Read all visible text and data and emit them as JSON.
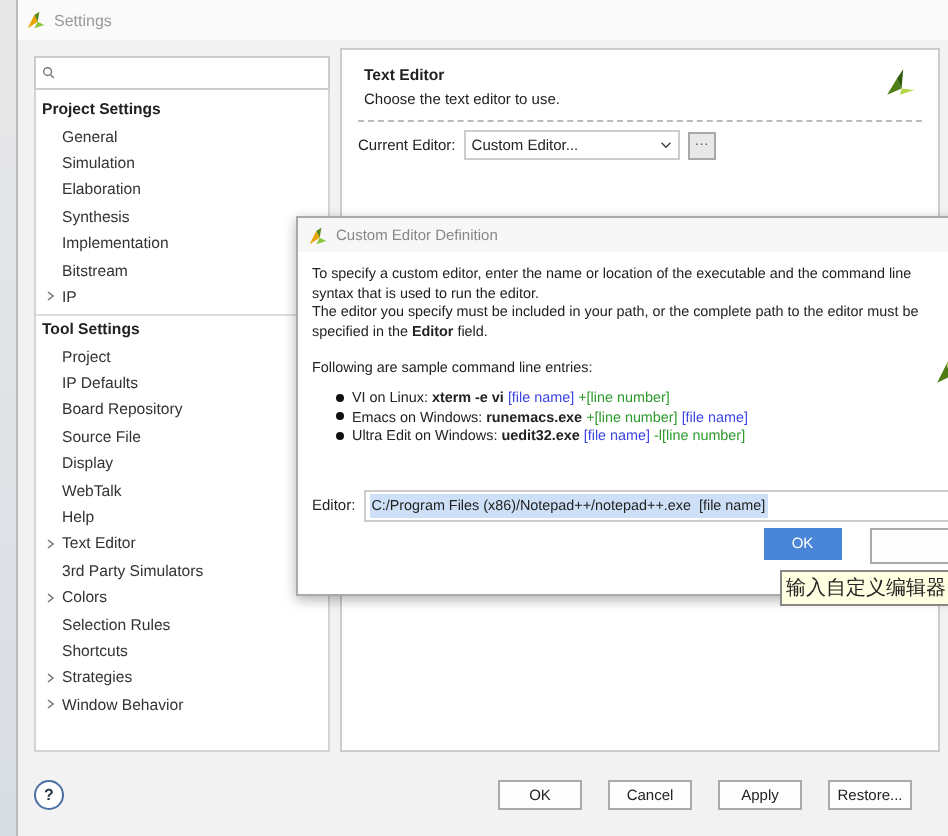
{
  "window": {
    "title": "Settings"
  },
  "tree": [
    {
      "label": "Project Settings",
      "kind": "header"
    },
    {
      "label": "General",
      "kind": "item"
    },
    {
      "label": "Simulation",
      "kind": "item"
    },
    {
      "label": "Elaboration",
      "kind": "item"
    },
    {
      "label": "Synthesis",
      "kind": "item"
    },
    {
      "label": "Implementation",
      "kind": "item"
    },
    {
      "label": "Bitstream",
      "kind": "item"
    },
    {
      "label": "IP",
      "kind": "item",
      "expanded": false
    },
    {
      "label": "Tool Settings",
      "kind": "header"
    },
    {
      "label": "Project",
      "kind": "item"
    },
    {
      "label": "IP Defaults",
      "kind": "item"
    },
    {
      "label": "Board Repository",
      "kind": "item"
    },
    {
      "label": "Source File",
      "kind": "item"
    },
    {
      "label": "Display",
      "kind": "item"
    },
    {
      "label": "WebTalk",
      "kind": "item"
    },
    {
      "label": "Help",
      "kind": "item"
    },
    {
      "label": "Text Editor",
      "kind": "item",
      "expanded": false
    },
    {
      "label": "3rd Party Simulators",
      "kind": "item"
    },
    {
      "label": "Colors",
      "kind": "item",
      "expanded": false
    },
    {
      "label": "Selection Rules",
      "kind": "item"
    },
    {
      "label": "Shortcuts",
      "kind": "item"
    },
    {
      "label": "Strategies",
      "kind": "item",
      "expanded": false
    },
    {
      "label": "Window Behavior",
      "kind": "item",
      "expanded": false
    }
  ],
  "panel": {
    "title": "Text Editor",
    "description": "Choose the text editor to use.",
    "editor_label": "Current Editor:",
    "editor_value": "Custom Editor...",
    "browse_button": "···"
  },
  "help_button": "?",
  "buttons": [
    "OK",
    "Cancel",
    "Apply",
    "Restore..."
  ],
  "dialog": {
    "title": "Custom Editor Definition",
    "paragraphs": [
      "To specify a custom editor, enter the name or location of the executable and the command line syntax that is used to run the editor.",
      "The editor you specify must be included in your path, or the complete path to the editor must be specified in the **Editor** field.",
      "Following are sample command line entries:"
    ],
    "samples": [
      [
        {
          "kind": "plain",
          "text": "VI on Linux:"
        },
        {
          "kind": "command",
          "text": "xterm -e vi"
        },
        {
          "kind": "file",
          "text": "[file name]"
        },
        {
          "kind": "line",
          "text": "+[line number]"
        }
      ],
      [
        {
          "kind": "plain",
          "text": "Emacs on Windows:"
        },
        {
          "kind": "command",
          "text": "runemacs.exe"
        },
        {
          "kind": "line",
          "text": "+[line number]"
        },
        {
          "kind": "file",
          "text": "[file name]"
        }
      ],
      [
        {
          "kind": "plain",
          "text": "Ultra Edit on Windows:"
        },
        {
          "kind": "command",
          "text": "uedit32.exe"
        },
        {
          "kind": "file",
          "text": "[file name]"
        },
        {
          "kind": "line",
          "text": "-l[line number]"
        }
      ]
    ],
    "editor_label": "Editor:",
    "editor_value": "C:/Program Files (x86)/Notepad++/notepad++.exe  [file name]",
    "value_selected": true,
    "ok_button": "OK"
  },
  "tooltip": "输入自定义编辑器"
}
